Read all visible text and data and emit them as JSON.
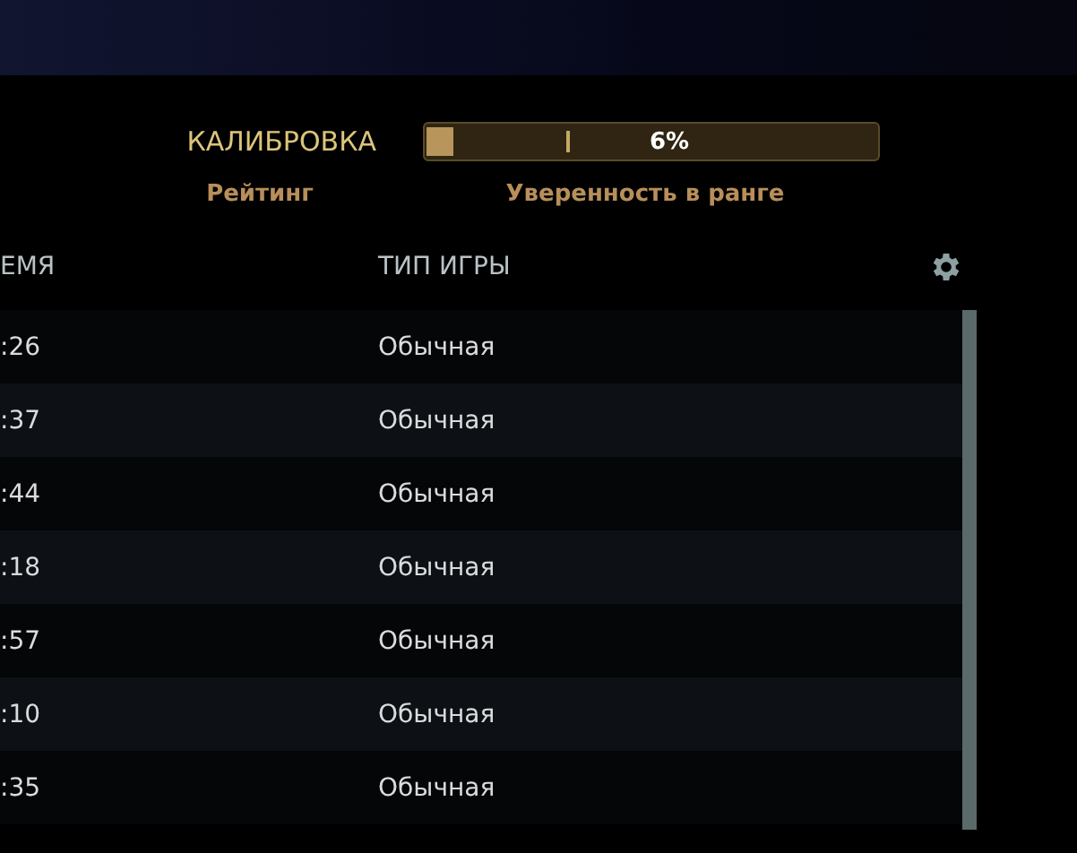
{
  "calibration": {
    "label": "КАЛИБРОВКА",
    "level": 0.06,
    "reading": "6%",
    "rating_label": "Рейтинг",
    "confidence_label": "Уверенность в ранге"
  },
  "table": {
    "columns": [
      "ЕМЯ",
      "ТИП ИГРЫ"
    ],
    "rows": [
      {
        "time": ":26",
        "type": "Обычная"
      },
      {
        "time": ":37",
        "type": "Обычная"
      },
      {
        "time": ":44",
        "type": "Обычная"
      },
      {
        "time": ":18",
        "type": "Обычная"
      },
      {
        "time": ":57",
        "type": "Обычная"
      },
      {
        "time": ":10",
        "type": "Обычная"
      },
      {
        "time": ":35",
        "type": "Обычная"
      }
    ]
  }
}
